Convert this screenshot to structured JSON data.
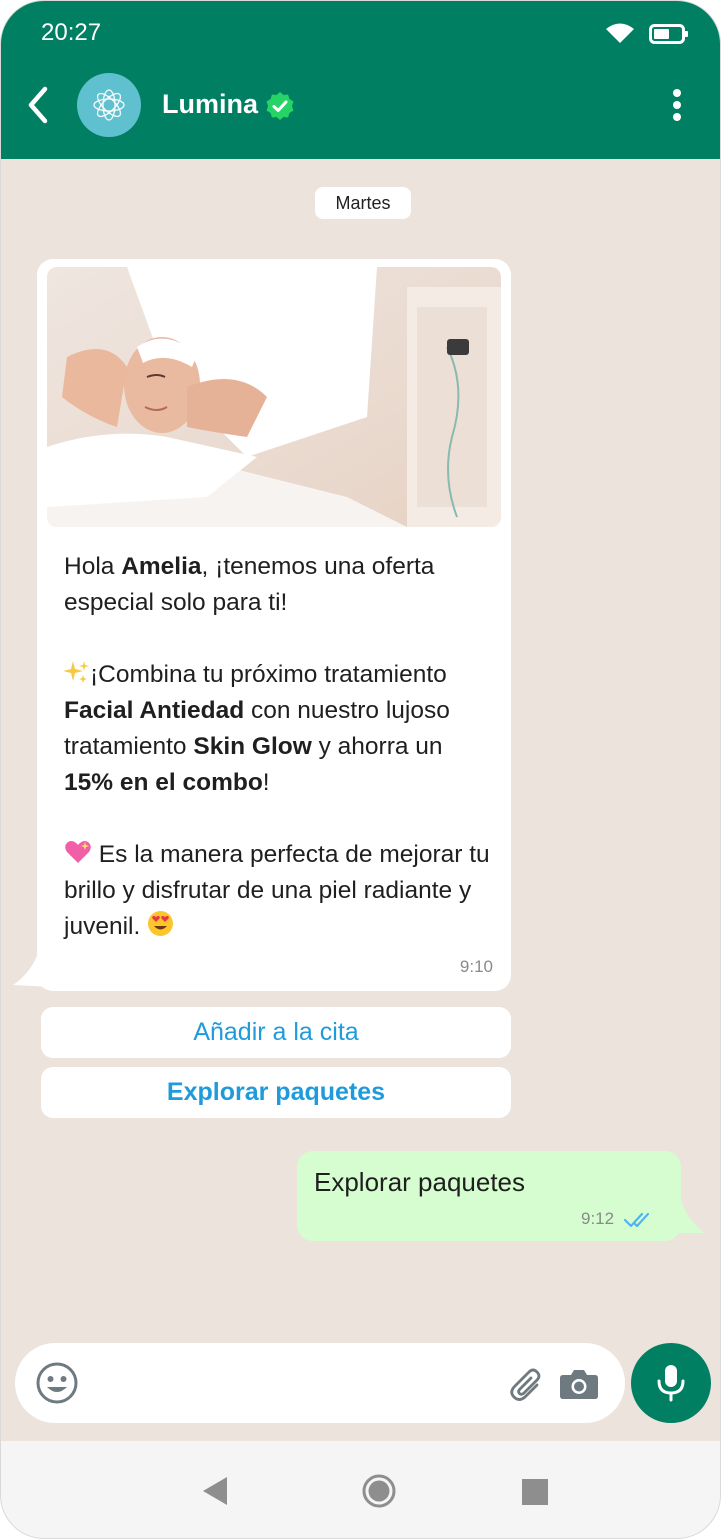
{
  "status_bar": {
    "time": "20:27",
    "icons": [
      "wifi-icon",
      "battery-icon"
    ]
  },
  "header": {
    "contact_name": "Lumina",
    "verified": true,
    "color": "#007f63",
    "avatar_color": "#5fc1cf",
    "icons": [
      "back-arrow-icon",
      "lotus-logo-icon",
      "verified-check-icon",
      "more-vertical-icon"
    ]
  },
  "date_chip": "Martes",
  "incoming_message": {
    "image": "spa-facial-massage-photo",
    "greeting_pre": "Hola ",
    "greeting_name": "Amelia",
    "greeting_post": ", ¡tenemos una oferta especial solo para ti!",
    "p2_emoji": "sparkles-emoji",
    "p2_a": "¡Combina tu próximo tratamiento ",
    "p2_b": "Facial Antiedad",
    "p2_c": " con nuestro lujoso tratamiento ",
    "p2_d": "Skin Glow",
    "p2_e": " y ahorra un ",
    "p2_f": "15% en el combo",
    "p2_g": "!",
    "p3_emoji": "sparkling-heart-emoji",
    "p3_text": " Es la manera perfecta de mejorar tu brillo y disfrutar de una piel radiante y juvenil. ",
    "p3_end_emoji": "heart-eyes-emoji",
    "time": "9:10"
  },
  "quick_replies": [
    {
      "label": "Añadir a la cita"
    },
    {
      "label": "Explorar paquetes"
    }
  ],
  "outgoing_message": {
    "text": "Explorar paquetes",
    "time": "9:12",
    "status": "read",
    "bubble_color": "#d5fdd0",
    "tick_color": "#4fb6ec"
  },
  "composer": {
    "placeholder": "",
    "icons": [
      "emoji-icon",
      "attach-icon",
      "camera-icon",
      "mic-icon"
    ]
  },
  "nav_bar": {
    "icons": [
      "nav-back-icon",
      "nav-home-icon",
      "nav-recent-icon"
    ]
  }
}
